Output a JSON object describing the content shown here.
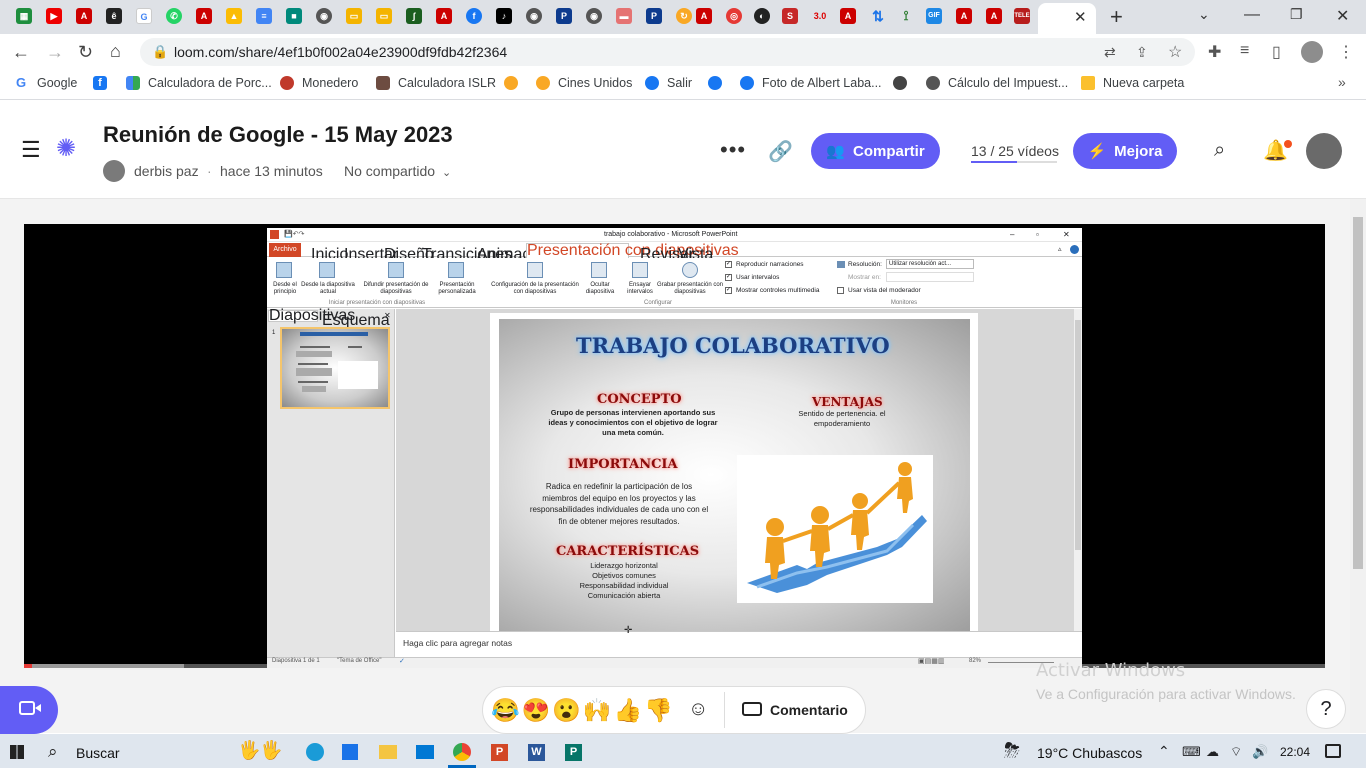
{
  "browser": {
    "url": "loom.com/share/4ef1b0f002a04e23900df9fdb42f2364",
    "bookmarks": [
      "Google",
      "Calculadora de Porc...",
      "Monedero",
      "Calculadora ISLR",
      "Cines Unidos",
      "Salir",
      "Foto de Albert Laba...",
      "Cálculo del Impuest...",
      "Nueva carpeta"
    ],
    "tab_badge": "3.0"
  },
  "loom": {
    "title": "Reunión de Google - 15 May 2023",
    "author": "derbis paz",
    "time": "hace 13 minutos",
    "sharing": "No compartido",
    "share_button": "Compartir",
    "video_count": "13 / 25 vídeos",
    "upgrade_button": "Mejora",
    "comment_button": "Comentario",
    "help": "?",
    "reactions": [
      "😂",
      "😍",
      "😮",
      "🙌",
      "👍",
      "👎"
    ]
  },
  "ppt": {
    "window_title": "trabajo colaborativo - Microsoft PowerPoint",
    "tabs": [
      "Archivo",
      "Inicio",
      "Insertar",
      "Diseño",
      "Transiciones",
      "Animaciones",
      "Presentación con diapositivas",
      "Revisar",
      "Vista"
    ],
    "ribbon": {
      "desde_principio": "Desde el principio",
      "desde_actual": "Desde la diapositiva actual",
      "difundir": "Difundir presentación de diapositivas",
      "personalizada": "Presentación personalizada",
      "configuracion": "Configuración de la presentación con diapositivas",
      "ocultar": "Ocultar diapositiva",
      "ensayar": "Ensayar intervalos",
      "grabar": "Grabar presentación con diapositivas",
      "chk_narraciones": "Reproducir narraciones",
      "chk_intervalos": "Usar intervalos",
      "chk_controles": "Mostrar controles multimedia",
      "resolucion_label": "Resolución:",
      "resolucion_value": "Utilizar resolución act...",
      "mostrar_en": "Mostrar en:",
      "vista_moderador": "Usar vista del moderador",
      "group_iniciar": "Iniciar presentación con diapositivas",
      "group_configurar": "Configurar",
      "group_monitores": "Monitores"
    },
    "pane_tabs": [
      "Diapositivas",
      "Esquema"
    ],
    "thumb_number": "1",
    "notes_placeholder": "Haga clic para agregar notas",
    "status_left": "Diapositiva 1 de 1",
    "status_theme": "\"Tema de Office\"",
    "zoom": "82%"
  },
  "slide": {
    "title": "TRABAJO COLABORATIVO",
    "concepto_h": "CONCEPTO",
    "concepto_t": "Grupo de personas intervienen aportando sus ideas y conocimientos con el objetivo de lograr una meta común.",
    "ventajas_h": "VENTAJAS",
    "ventajas_t": "Sentido de pertenencia. el empoderamiento",
    "importancia_h": "IMPORTANCIA",
    "importancia_t": "Radica en redefinir la participación de los miembros del equipo en los proyectos y las responsabilidades individuales de cada uno con el fin de obtener mejores resultados.",
    "caract_h": "CARACTERÍSTICAS",
    "caract_items": [
      "Liderazgo horizontal",
      "Objetivos comunes",
      "Responsabilidad individual",
      "Comunicación abierta"
    ]
  },
  "overlay": {
    "activar_title": "Activar Windows",
    "activar_sub": "Ve a Configuración para activar Windows."
  },
  "taskbar": {
    "search": "Buscar",
    "weather": "19°C  Chubascos",
    "time": "22:04"
  }
}
